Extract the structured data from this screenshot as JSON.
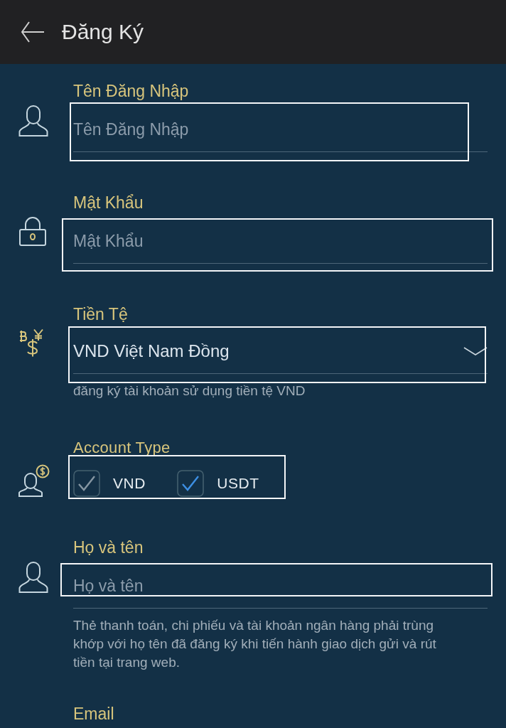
{
  "header": {
    "title": "Đăng Ký"
  },
  "fields": [
    {
      "kind": "text",
      "label": "Tên Đăng Nhập",
      "placeholder": "Tên Đăng Nhập"
    },
    {
      "kind": "password",
      "label": "Mật Khẩu",
      "placeholder": "Mật Khẩu"
    },
    {
      "kind": "select",
      "label": "Tiền Tệ",
      "value": "VND Việt Nam Đồng",
      "hint": "đăng ký tài khoản sử dụng tiền tệ VND"
    },
    {
      "kind": "checkboxes",
      "label": "Account Type",
      "options": [
        {
          "label": "VND",
          "checked": true,
          "disabled": true
        },
        {
          "label": "USDT",
          "checked": true,
          "disabled": false
        }
      ]
    },
    {
      "kind": "text",
      "label": "Họ và tên",
      "placeholder": "Họ và tên",
      "hint": "Thẻ thanh toán, chi phiếu và tài khoản ngân hàng phải trùng khớp với họ tên đã đăng ký khi tiến hành giao dịch gửi và rút tiền tại trang web."
    },
    {
      "kind": "label_only",
      "label": "Email"
    }
  ]
}
